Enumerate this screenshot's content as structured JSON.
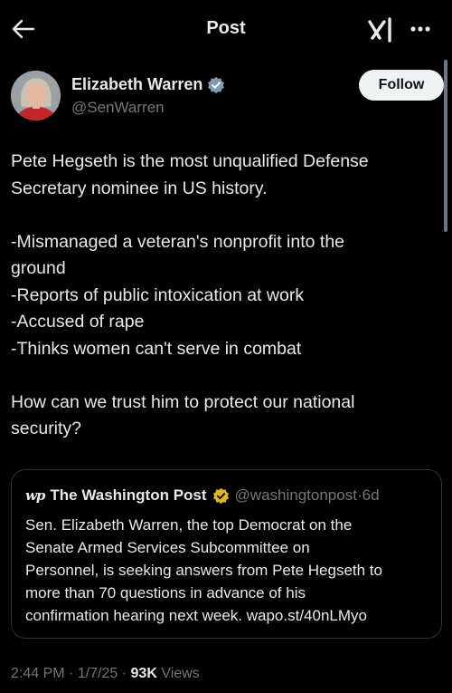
{
  "topbar": {
    "title": "Post",
    "back_icon": "arrow-left-icon",
    "grok_icon": "grok-icon",
    "more_icon": "more-horizontal-icon"
  },
  "author": {
    "name": "Elizabeth Warren",
    "handle": "@SenWarren",
    "verified_color": "#829aab",
    "follow_label": "Follow"
  },
  "tweet": {
    "lines": [
      "Pete Hegseth is the most unqualified Defense",
      "Secretary nominee in US history.",
      "",
      "-Mismanaged a veteran's nonprofit into the",
      "ground",
      "-Reports of public intoxication at work",
      "-Accused of rape",
      "-Thinks women can't serve in combat",
      "",
      "How can we trust him to protect our national",
      "security?"
    ]
  },
  "quote": {
    "logo": "wp",
    "name": "The Washington Post",
    "verified_color": "#e2b719",
    "handle": "@washingtonpost",
    "separator": "·",
    "age": "6d",
    "lines": [
      "Sen. Elizabeth Warren, the top Democrat on the",
      "Senate Armed Services Subcommittee on",
      "Personnel, is seeking answers from Pete Hegseth to",
      "more than 70 questions in advance of his",
      "confirmation hearing next week. wapo.st/40nLMyo"
    ]
  },
  "footer": {
    "time": "2:44 PM",
    "sep1": " · ",
    "date": "1/7/25",
    "sep2": " · ",
    "views_count": "93K",
    "views_label": " Views"
  }
}
